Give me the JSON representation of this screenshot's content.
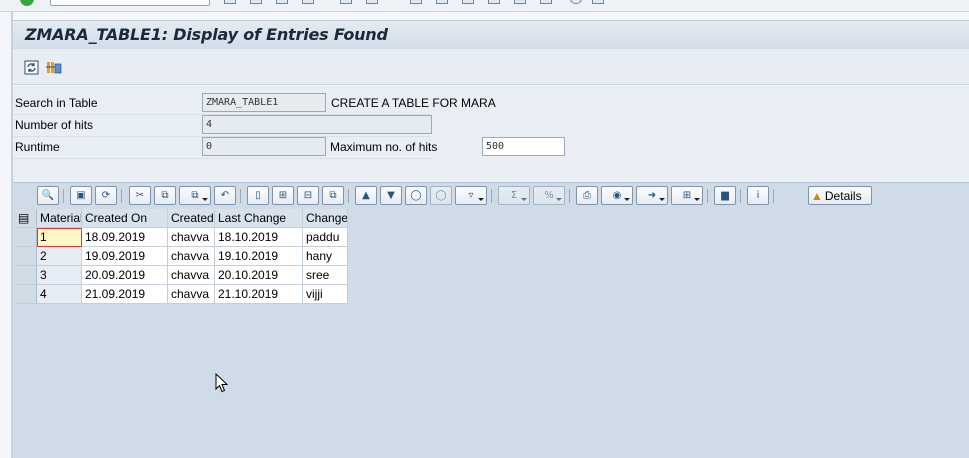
{
  "title": "ZMARA_TABLE1: Display of Entries Found",
  "app_toolbar": {
    "icons": [
      "refresh-icon",
      "table-settings-icon"
    ]
  },
  "header": {
    "search_in_table": {
      "label": "Search in Table",
      "value": "ZMARA_TABLE1",
      "description": "CREATE A TABLE FOR MARA"
    },
    "number_of_hits": {
      "label": "Number of hits",
      "value": "4"
    },
    "runtime": {
      "label": "Runtime",
      "value": "0"
    },
    "max_hits": {
      "label": "Maximum no. of hits",
      "value": "500"
    }
  },
  "alv_toolbar": {
    "details_label": "Details"
  },
  "grid": {
    "columns": [
      "Material",
      "Created On",
      "Created",
      "Last Change",
      "Change"
    ],
    "rows": [
      [
        "1",
        "18.09.2019",
        "chavva",
        "18.10.2019",
        "paddu"
      ],
      [
        "2",
        "19.09.2019",
        "chavva",
        "19.10.2019",
        "hany"
      ],
      [
        "3",
        "20.09.2019",
        "chavva",
        "20.10.2019",
        "sree"
      ],
      [
        "4",
        "21.09.2019",
        "chavva",
        "21.10.2019",
        "vijji"
      ]
    ]
  },
  "colors": {
    "title_bg": "#d3dde8",
    "alv_bg": "#cfdbe7",
    "active_cell_border": "#d23b3b"
  }
}
